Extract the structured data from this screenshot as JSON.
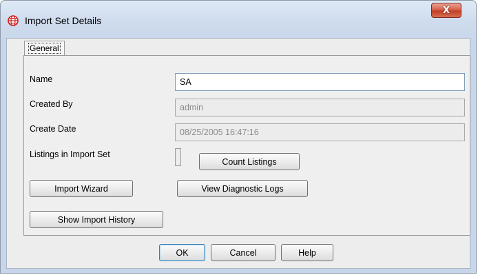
{
  "window": {
    "title": "Import Set Details",
    "close_symbol": "X"
  },
  "tabs": [
    {
      "label": "General",
      "selected": true
    }
  ],
  "form": {
    "name_label": "Name",
    "name_value": "SA",
    "created_by_label": "Created By",
    "created_by_value": "admin",
    "create_date_label": "Create Date",
    "create_date_value": "08/25/2005 16:47:16",
    "listings_label": "Listings in Import Set",
    "listings_count": ""
  },
  "buttons": {
    "count_listings": "Count Listings",
    "import_wizard": "Import Wizard",
    "view_diagnostic_logs": "View Diagnostic Logs",
    "show_import_history": "Show Import History",
    "ok": "OK",
    "cancel": "Cancel",
    "help": "Help"
  },
  "icons": {
    "app": "globe-icon",
    "close": "close-icon"
  },
  "colors": {
    "app_icon": "#d21f1f",
    "close_button": "#c8462e",
    "default_button_border": "#3c7fb1"
  }
}
